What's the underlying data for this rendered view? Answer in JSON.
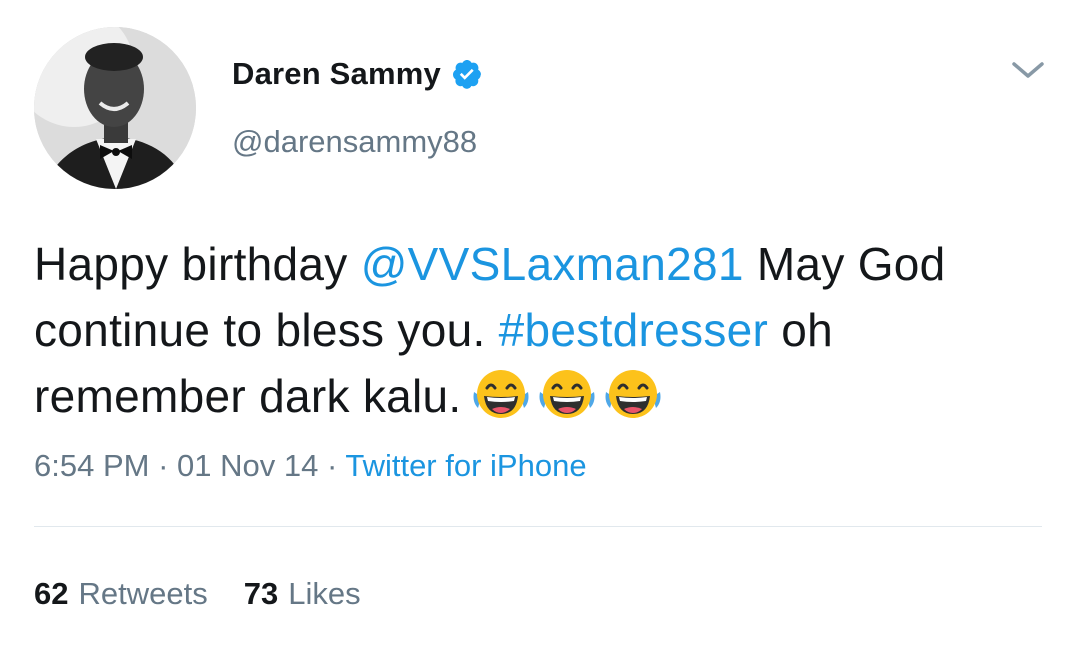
{
  "user": {
    "display_name": "Daren Sammy",
    "handle": "@darensammy88",
    "verified_icon": "verified-badge-icon",
    "avatar_icon": "avatar-photo"
  },
  "tweet": {
    "text_part1": "Happy birthday ",
    "mention": "@VVSLaxman281",
    "text_part2": " May God continue to bless you. ",
    "hashtag": "#bestdresser",
    "text_part3": " oh remember dark kalu.",
    "emojis": [
      "face-with-tears-of-joy-icon",
      "face-with-tears-of-joy-icon",
      "face-with-tears-of-joy-icon"
    ]
  },
  "meta": {
    "time": "6:54 PM",
    "sep1": " · ",
    "date": "01 Nov 14",
    "sep2": " · ",
    "source": "Twitter for iPhone"
  },
  "stats": {
    "retweets_count": "62",
    "retweets_label": "Retweets",
    "likes_count": "73",
    "likes_label": "Likes"
  },
  "colors": {
    "link": "#1b95e0",
    "secondary_text": "#657786",
    "primary_text": "#14171a",
    "verified": "#1da1f2",
    "divider": "#e1e8ed"
  },
  "menu_icon": "chevron-down-icon"
}
